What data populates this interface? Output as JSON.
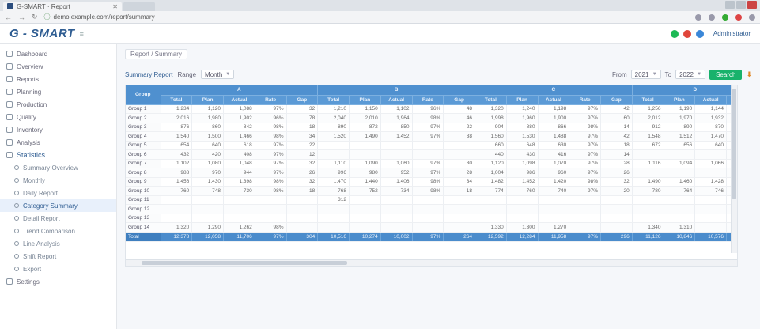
{
  "browser": {
    "tab_title": "G-SMART · Report",
    "url": "demo.example.com/report/summary",
    "nav_back": "←",
    "nav_forward": "→",
    "nav_reload": "↻"
  },
  "header": {
    "logo": "G - SMART",
    "logo_sub": "≡",
    "status": [
      "●",
      "●",
      "●"
    ],
    "user": "Administrator"
  },
  "sidebar": {
    "items": [
      {
        "label": "Dashboard"
      },
      {
        "label": "Overview"
      },
      {
        "label": "Reports"
      },
      {
        "label": "Planning"
      },
      {
        "label": "Production"
      },
      {
        "label": "Quality"
      },
      {
        "label": "Inventory"
      },
      {
        "label": "Analysis"
      },
      {
        "label": "Statistics"
      }
    ],
    "children": [
      {
        "label": "Summary Overview"
      },
      {
        "label": "Monthly"
      },
      {
        "label": "Daily Report"
      },
      {
        "label": "Category Summary"
      },
      {
        "label": "Detail Report"
      },
      {
        "label": "Trend Comparison"
      },
      {
        "label": "Line Analysis"
      },
      {
        "label": "Shift Report"
      },
      {
        "label": "Export"
      }
    ],
    "last": {
      "label": "Settings"
    }
  },
  "breadcrumb": "Report / Summary",
  "toolbar": {
    "title": "Summary Report",
    "range_label": "Range",
    "range_value": "Month",
    "from_label": "From",
    "from_value": "2021",
    "to_label": "To",
    "to_value": "2022",
    "search_button": "Search",
    "export_icon": "⬇"
  },
  "table": {
    "corner": "Group",
    "groups": [
      "A",
      "B",
      "C",
      "D"
    ],
    "subcols": [
      "Total",
      "Plan",
      "Actual",
      "Rate",
      "Gap"
    ],
    "rows": [
      {
        "label": "Group 1",
        "cells": [
          "1,234",
          "1,120",
          "1,088",
          "97%",
          "32",
          "1,210",
          "1,150",
          "1,102",
          "96%",
          "48",
          "1,320",
          "1,240",
          "1,198",
          "97%",
          "42",
          "1,256",
          "1,190",
          "1,144",
          "96%"
        ]
      },
      {
        "label": "Group 2",
        "cells": [
          "2,016",
          "1,980",
          "1,902",
          "96%",
          "78",
          "2,040",
          "2,010",
          "1,964",
          "98%",
          "46",
          "1,998",
          "1,960",
          "1,900",
          "97%",
          "60",
          "2,012",
          "1,970",
          "1,932",
          "98%"
        ]
      },
      {
        "label": "Group 3",
        "cells": [
          "876",
          "860",
          "842",
          "98%",
          "18",
          "890",
          "872",
          "850",
          "97%",
          "22",
          "904",
          "880",
          "866",
          "98%",
          "14",
          "912",
          "890",
          "870",
          "98%"
        ]
      },
      {
        "label": "Group 4",
        "cells": [
          "1,540",
          "1,500",
          "1,466",
          "98%",
          "34",
          "1,520",
          "1,490",
          "1,452",
          "97%",
          "38",
          "1,560",
          "1,530",
          "1,488",
          "97%",
          "42",
          "1,548",
          "1,512",
          "1,470",
          "97%"
        ]
      },
      {
        "label": "Group 5",
        "cells": [
          "654",
          "640",
          "618",
          "97%",
          "22",
          "",
          "",
          "",
          "",
          "",
          "660",
          "648",
          "630",
          "97%",
          "18",
          "672",
          "656",
          "640",
          "98%"
        ]
      },
      {
        "label": "Group 6",
        "cells": [
          "432",
          "420",
          "408",
          "97%",
          "12",
          "",
          "",
          "",
          "",
          "",
          "440",
          "430",
          "416",
          "97%",
          "14",
          "",
          "",
          "",
          ""
        ]
      },
      {
        "label": "Group 7",
        "cells": [
          "1,102",
          "1,080",
          "1,048",
          "97%",
          "32",
          "1,110",
          "1,090",
          "1,060",
          "97%",
          "30",
          "1,120",
          "1,098",
          "1,070",
          "97%",
          "28",
          "1,116",
          "1,094",
          "1,066",
          "97%"
        ]
      },
      {
        "label": "Group 8",
        "cells": [
          "988",
          "970",
          "944",
          "97%",
          "26",
          "996",
          "980",
          "952",
          "97%",
          "28",
          "1,004",
          "986",
          "960",
          "97%",
          "26",
          "",
          "",
          "",
          ""
        ]
      },
      {
        "label": "Group 9",
        "cells": [
          "1,456",
          "1,430",
          "1,398",
          "98%",
          "32",
          "1,470",
          "1,440",
          "1,406",
          "98%",
          "34",
          "1,482",
          "1,452",
          "1,420",
          "98%",
          "32",
          "1,490",
          "1,460",
          "1,428",
          "98%"
        ]
      },
      {
        "label": "Group 10",
        "cells": [
          "760",
          "748",
          "730",
          "98%",
          "18",
          "768",
          "752",
          "734",
          "98%",
          "18",
          "774",
          "760",
          "740",
          "97%",
          "20",
          "780",
          "764",
          "746",
          "98%"
        ]
      },
      {
        "label": "Group 11",
        "cells": [
          "",
          "",
          "",
          "",
          "",
          "312",
          "",
          "",
          "",
          "",
          "",
          "",
          "",
          "",
          "",
          "",
          "",
          "",
          ""
        ]
      },
      {
        "label": "Group 12",
        "cells": [
          "",
          "",
          "",
          "",
          "",
          "",
          "",
          "",
          "",
          "",
          "",
          "",
          "",
          "",
          "",
          "",
          "",
          "",
          ""
        ]
      },
      {
        "label": "Group 13",
        "cells": [
          "",
          "",
          "",
          "",
          "",
          "",
          "",
          "",
          "",
          "",
          "",
          "",
          "",
          "",
          "",
          "",
          "",
          "",
          ""
        ]
      },
      {
        "label": "Group 14",
        "cells": [
          "1,320",
          "1,290",
          "1,262",
          "98%",
          "",
          "",
          "",
          "",
          "",
          "",
          "1,330",
          "1,300",
          "1,270",
          "",
          "",
          "1,340",
          "1,310",
          "",
          ""
        ]
      }
    ],
    "total": {
      "label": "Total",
      "cells": [
        "12,378",
        "12,058",
        "11,706",
        "97%",
        "304",
        "10,516",
        "10,274",
        "10,002",
        "97%",
        "264",
        "12,592",
        "12,284",
        "11,958",
        "97%",
        "296",
        "11,126",
        "10,846",
        "10,576",
        "97%"
      ]
    }
  }
}
